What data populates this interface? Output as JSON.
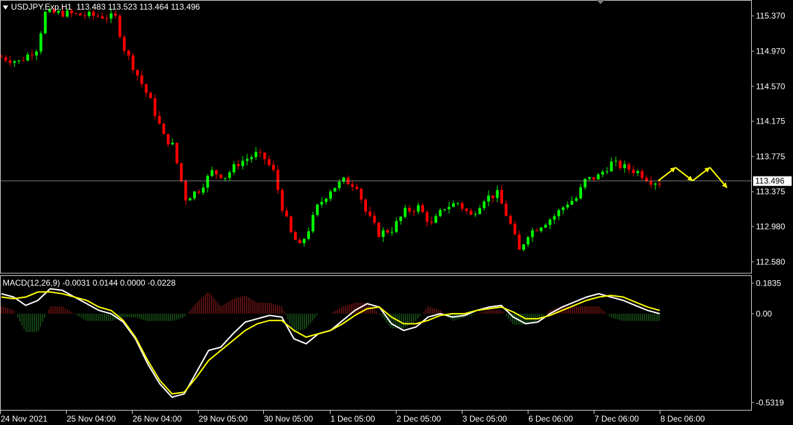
{
  "header": {
    "symbol": "USDJPY.Exp,H1",
    "ohlc": "113.483 113.523 113.464 113.496"
  },
  "macd": {
    "label": "MACD(12,26,9) -0.0031 0.0144 0.0000 -0.0228"
  },
  "colors": {
    "background": "#000000",
    "bull": "#00ff00",
    "bear": "#ff0000",
    "macd_line": "#ffffff",
    "signal_line": "#ffff00",
    "hist_pos": "#8b1a1a",
    "hist_neg": "#1f6b1f",
    "arrows": "#ffff00",
    "price_line": "#c0c0c0"
  },
  "chart_data": [
    {
      "type": "candlestick",
      "title": "USDJPY.Exp,H1",
      "y_ticks": [
        "115.370",
        "114.970",
        "114.570",
        "114.175",
        "113.775",
        "113.375",
        "112.980",
        "112.580"
      ],
      "ylim": [
        112.45,
        115.55
      ],
      "current_price": "113.496",
      "x_ticks": [
        "24 Nov 2021",
        "25 Nov 04:00",
        "26 Nov 04:00",
        "29 Nov 05:00",
        "30 Nov 05:00",
        "1 Dec 05:00",
        "2 Dec 05:00",
        "3 Dec 05:00",
        "6 Dec 06:00",
        "7 Dec 06:00",
        "8 Dec 06:00"
      ],
      "close_path": [
        [
          0,
          114.9
        ],
        [
          4,
          114.85
        ],
        [
          8,
          115.0
        ],
        [
          10,
          115.4
        ],
        [
          14,
          115.4
        ],
        [
          18,
          115.38
        ],
        [
          22,
          115.37
        ],
        [
          26,
          115.35
        ],
        [
          28,
          115.0
        ],
        [
          31,
          114.7
        ],
        [
          34,
          114.4
        ],
        [
          37,
          114.0
        ],
        [
          39,
          113.9
        ],
        [
          40,
          113.7
        ],
        [
          42,
          113.3
        ],
        [
          45,
          113.4
        ],
        [
          48,
          113.6
        ],
        [
          51,
          113.55
        ],
        [
          54,
          113.7
        ],
        [
          58,
          113.8
        ],
        [
          60,
          113.75
        ],
        [
          62,
          113.6
        ],
        [
          64,
          113.2
        ],
        [
          66,
          112.9
        ],
        [
          68,
          112.75
        ],
        [
          70,
          112.95
        ],
        [
          72,
          113.2
        ],
        [
          75,
          113.4
        ],
        [
          78,
          113.5
        ],
        [
          81,
          113.45
        ],
        [
          83,
          113.15
        ],
        [
          86,
          112.9
        ],
        [
          89,
          112.95
        ],
        [
          92,
          113.15
        ],
        [
          95,
          113.2
        ],
        [
          98,
          113.0
        ],
        [
          101,
          113.2
        ],
        [
          104,
          113.25
        ],
        [
          107,
          113.1
        ],
        [
          110,
          113.3
        ],
        [
          113,
          113.35
        ],
        [
          116,
          113.0
        ],
        [
          118,
          112.7
        ],
        [
          120,
          112.9
        ],
        [
          123,
          113.0
        ],
        [
          126,
          113.1
        ],
        [
          129,
          113.25
        ],
        [
          131,
          113.3
        ],
        [
          133,
          113.5
        ],
        [
          136,
          113.55
        ],
        [
          139,
          113.7
        ],
        [
          142,
          113.65
        ],
        [
          145,
          113.6
        ],
        [
          148,
          113.5
        ],
        [
          150,
          113.48
        ]
      ],
      "forecast_arrows": [
        113.5,
        113.65,
        113.5,
        113.65,
        113.42
      ]
    },
    {
      "type": "line",
      "title": "MACD(12,26,9)",
      "y_ticks": [
        "0.1835",
        "0.00",
        "-0.5319"
      ],
      "ylim": [
        -0.58,
        0.23
      ],
      "series": [
        {
          "name": "MACD",
          "values": [
            0.12,
            0.1,
            0.05,
            0.08,
            0.15,
            0.14,
            0.1,
            0.06,
            0.02,
            0.0,
            -0.05,
            -0.15,
            -0.3,
            -0.42,
            -0.5,
            -0.48,
            -0.35,
            -0.22,
            -0.2,
            -0.12,
            -0.05,
            -0.03,
            -0.01,
            -0.02,
            -0.15,
            -0.18,
            -0.12,
            -0.1,
            -0.04,
            0.02,
            0.06,
            0.04,
            -0.06,
            -0.1,
            -0.08,
            -0.02,
            0.0,
            -0.02,
            -0.01,
            0.02,
            0.04,
            0.05,
            -0.02,
            -0.06,
            -0.05,
            0.0,
            0.04,
            0.07,
            0.1,
            0.12,
            0.1,
            0.08,
            0.05,
            0.02,
            0.0
          ]
        },
        {
          "name": "Signal",
          "values": [
            0.1,
            0.09,
            0.1,
            0.13,
            0.13,
            0.12,
            0.1,
            0.08,
            0.04,
            0.02,
            -0.04,
            -0.14,
            -0.28,
            -0.4,
            -0.48,
            -0.47,
            -0.38,
            -0.28,
            -0.22,
            -0.16,
            -0.1,
            -0.06,
            -0.04,
            -0.04,
            -0.1,
            -0.14,
            -0.12,
            -0.1,
            -0.06,
            -0.01,
            0.03,
            0.04,
            -0.02,
            -0.06,
            -0.06,
            -0.04,
            -0.01,
            0.0,
            0.0,
            0.02,
            0.03,
            0.04,
            0.01,
            -0.03,
            -0.03,
            -0.01,
            0.02,
            0.05,
            0.08,
            0.1,
            0.11,
            0.1,
            0.07,
            0.04,
            0.02
          ]
        }
      ]
    }
  ]
}
